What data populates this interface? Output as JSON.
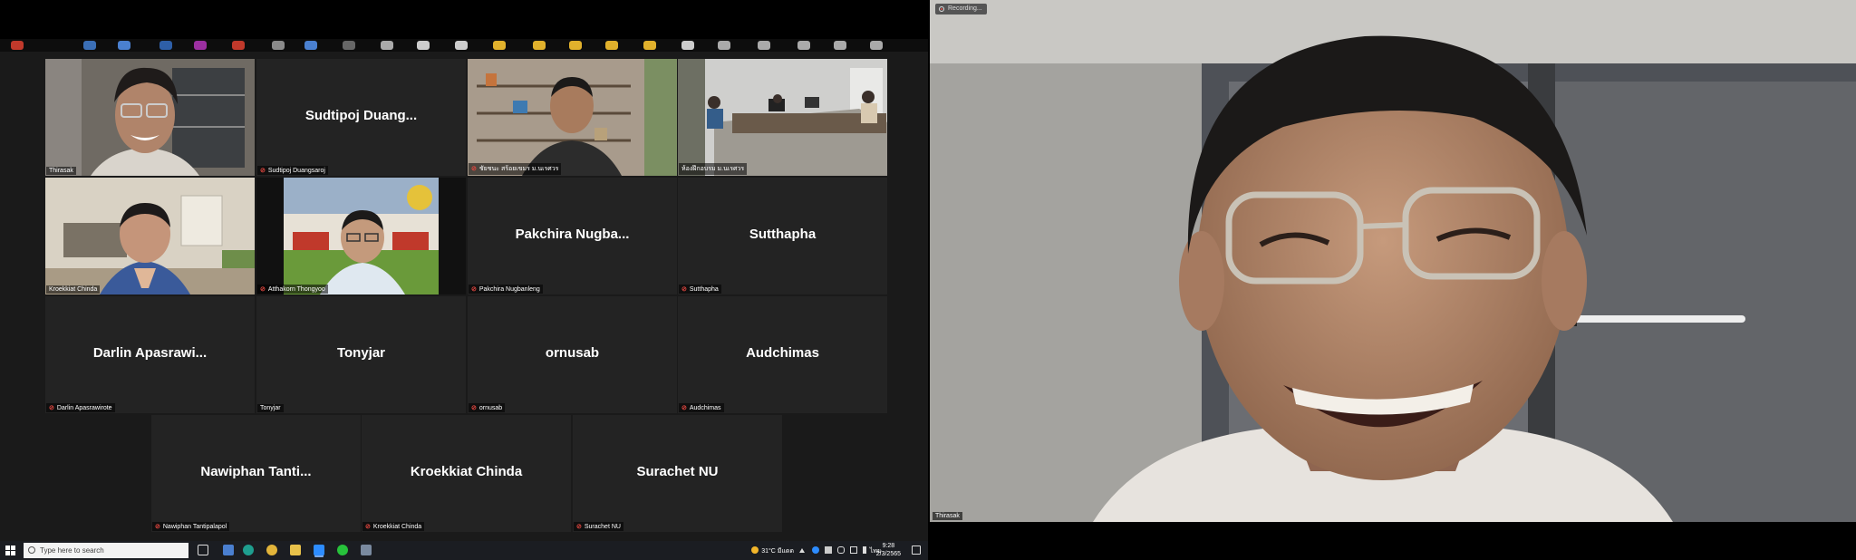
{
  "meeting": {
    "recording_label": "Recording...",
    "active_speaker_label": "Thirasak",
    "tiles": [
      {
        "id": "t1",
        "display_name": "",
        "label": "Thirasak",
        "muted": false,
        "video": true
      },
      {
        "id": "t2",
        "display_name": "Sudtipoj  Duang...",
        "label": "Sudtipoj Duangsaroj",
        "muted": true,
        "video": false
      },
      {
        "id": "t3",
        "display_name": "",
        "label": "ชัยชนะ สร้อยเขมร ม.นเรศวร",
        "muted": true,
        "video": true
      },
      {
        "id": "t4",
        "display_name": "",
        "label": "ห้องฝึกอบรม ม.นเรศวร",
        "muted": false,
        "video": true
      },
      {
        "id": "t5",
        "display_name": "",
        "label": "Kroekkiat Chinda",
        "muted": false,
        "video": true
      },
      {
        "id": "t6",
        "display_name": "",
        "label": "Atthakorn Thongyoo",
        "muted": true,
        "video": true
      },
      {
        "id": "t7",
        "display_name": "Pakchira  Nugba...",
        "label": "Pakchira Nugbanleng",
        "muted": true,
        "video": false
      },
      {
        "id": "t8",
        "display_name": "Sutthapha",
        "label": "Sutthapha",
        "muted": true,
        "video": false
      },
      {
        "id": "t9",
        "display_name": "Darlin  Apasrawi...",
        "label": "Darlin Apasrawirote",
        "muted": true,
        "video": false
      },
      {
        "id": "t10",
        "display_name": "Tonyjar",
        "label": "Tonyjar",
        "muted": false,
        "video": false
      },
      {
        "id": "t11",
        "display_name": "ornusab",
        "label": "ornusab",
        "muted": true,
        "video": false
      },
      {
        "id": "t12",
        "display_name": "Audchimas",
        "label": "Audchimas",
        "muted": true,
        "video": false
      },
      {
        "id": "t13",
        "display_name": "Nawiphan  Tanti...",
        "label": "Nawiphan Tantipalapol",
        "muted": true,
        "video": false
      },
      {
        "id": "t14",
        "display_name": "Kroekkiat  Chinda",
        "label": "Kroekkiat Chinda",
        "muted": true,
        "video": false
      },
      {
        "id": "t15",
        "display_name": "Surachet  NU",
        "label": "Surachet NU",
        "muted": true,
        "video": false
      }
    ]
  },
  "taskbar": {
    "search_placeholder": "Type here to search",
    "weather": "31°C  มีแดด",
    "lang": "ไทย",
    "time": "9:28",
    "date": "2/3/2565"
  },
  "colors": {
    "active_border": "#b8cf6f",
    "muted_icon": "#e0463f",
    "tile_bg": "#232323",
    "grid_bg": "#1a1a1a"
  }
}
